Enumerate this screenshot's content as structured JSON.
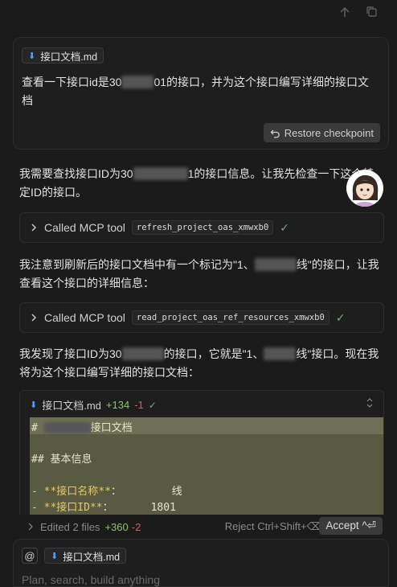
{
  "user_message": {
    "attachment": "接口文档.md",
    "text_before": "查看一下接口id是30",
    "text_after": "01的接口，并为这个接口编写详细的接口文档",
    "restore_label": "Restore checkpoint"
  },
  "messages": {
    "m1_before": "我需要查找接口ID为30",
    "m1_after": "1的接口信息。让我先检查一下这个特定ID的接口。",
    "tool1": {
      "label": "Called MCP tool",
      "name": "refresh_project_oas_xmwxb0"
    },
    "m2_before": "我注意到刷新后的接口文档中有一个标记为\"1、",
    "m2_after": "线\"的接口，让我查看这个接口的详细信息：",
    "tool2": {
      "label": "Called MCP tool",
      "name": "read_project_oas_ref_resources_xmwxb0"
    },
    "m3_before": "我发现了接口ID为30",
    "m3_mid": "的接口，它就是\"1、",
    "m3_after": "线\"接口。现在我将为这个接口编写详细的接口文档："
  },
  "code_block": {
    "filename": "接口文档.md",
    "added": "+134",
    "removed": "-1",
    "line1_a": "# ",
    "line1_b": "接口文档",
    "line2": "## 基本信息",
    "line3_key": "- **接口名称**",
    "line3_val": "：        线",
    "line4_key": "- **接口ID**",
    "line4_val": "：      1801"
  },
  "status_bar": {
    "edited": "Edited 2 files",
    "added": "+360",
    "removed": "-2",
    "reject": "Reject Ctrl+Shift+⌫",
    "accept": "Accept ^⏎"
  },
  "composer": {
    "at": "@",
    "attachment": "接口文档.md",
    "placeholder": "Plan, search, build anything"
  },
  "colors": {
    "accent_blue": "#4ea1ff",
    "added_green": "#8fc46a",
    "removed_red": "#e05a5a",
    "diff_bg": "#585a42"
  }
}
